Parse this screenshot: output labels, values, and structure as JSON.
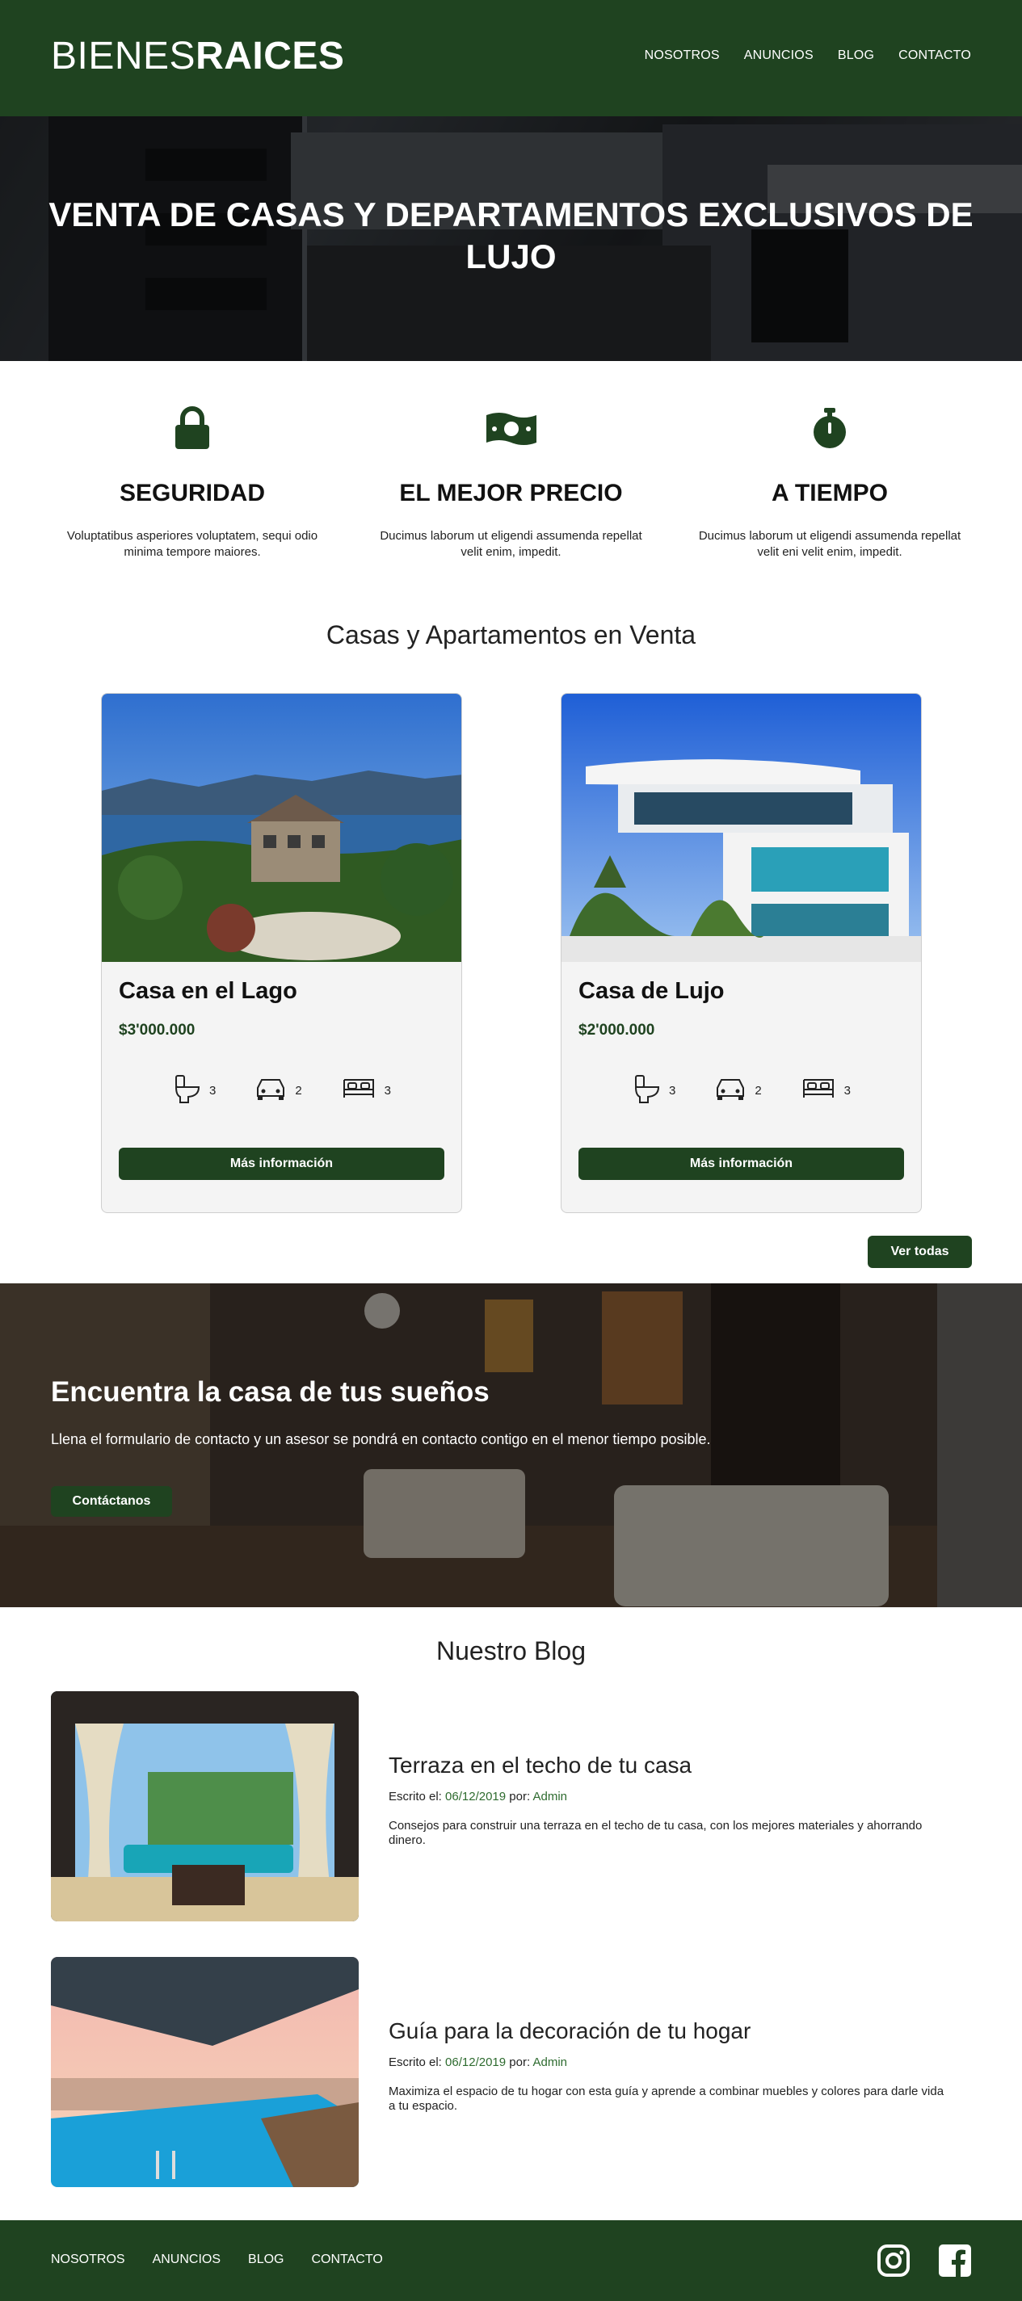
{
  "header": {
    "logo_light": "BIENES",
    "logo_bold": "RAICES",
    "nav": [
      "NOSOTROS",
      "ANUNCIOS",
      "BLOG",
      "CONTACTO"
    ]
  },
  "hero": {
    "title": "VENTA DE CASAS Y DEPARTAMENTOS EXCLUSIVOS DE LUJO"
  },
  "features": [
    {
      "icon": "lock-icon",
      "title": "SEGURIDAD",
      "text": "Voluptatibus asperiores voluptatem, sequi odio minima tempore maiores."
    },
    {
      "icon": "money-icon",
      "title": "EL MEJOR PRECIO",
      "text": "Ducimus laborum ut eligendi assumenda repellat velit enim, impedit."
    },
    {
      "icon": "stopwatch-icon",
      "title": "A TIEMPO",
      "text": "Ducimus laborum ut eligendi assumenda repellat velit eni velit enim, impedit."
    }
  ],
  "listings": {
    "title": "Casas y Apartamentos en Venta",
    "items": [
      {
        "name": "Casa en el Lago",
        "price": "$3'000.000",
        "baths": "3",
        "parking": "2",
        "rooms": "3",
        "button": "Más información"
      },
      {
        "name": "Casa de Lujo",
        "price": "$2'000.000",
        "baths": "3",
        "parking": "2",
        "rooms": "3",
        "button": "Más información"
      }
    ],
    "view_all": "Ver todas"
  },
  "contact_banner": {
    "title": "Encuentra la casa de tus sueños",
    "text": "Llena el formulario de contacto y un asesor se pondrá en contacto contigo en el menor tiempo posible.",
    "button": "Contáctanos"
  },
  "blog": {
    "title": "Nuestro Blog",
    "posts": [
      {
        "title": "Terraza en el techo de tu casa",
        "meta_prefix": "Escrito el:",
        "date": "06/12/2019",
        "by": "por:",
        "author": "Admin",
        "text": "Consejos para construir una terraza en el techo de tu casa, con los mejores materiales y ahorrando dinero."
      },
      {
        "title": "Guía para la decoración de tu hogar",
        "meta_prefix": "Escrito el:",
        "date": "06/12/2019",
        "by": "por:",
        "author": "Admin",
        "text": "Maximiza el espacio de tu hogar con esta guía y aprende a combinar muebles y colores para darle vida a tu espacio."
      }
    ]
  },
  "footer": {
    "nav": [
      "NOSOTROS",
      "ANUNCIOS",
      "BLOG",
      "CONTACTO"
    ],
    "social": [
      "instagram-icon",
      "facebook-icon"
    ]
  },
  "colors": {
    "brand_green": "#1f4320",
    "accent_green": "#2e6b2f"
  }
}
